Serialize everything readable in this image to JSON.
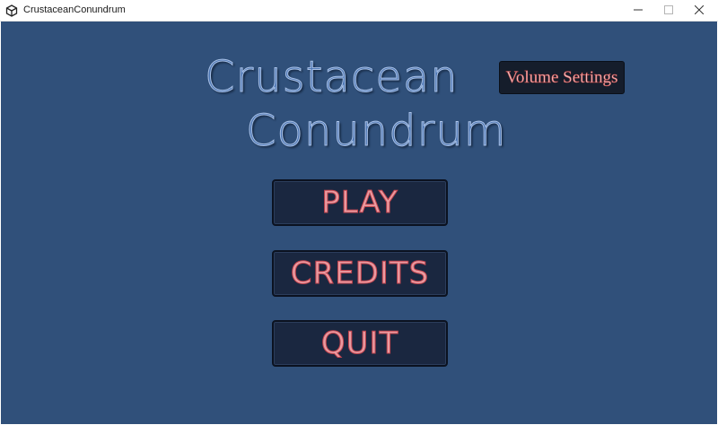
{
  "window": {
    "title": "CrustaceanConundrum",
    "icon": "unity-icon",
    "controls": {
      "minimize_icon": "minimize-icon",
      "maximize_icon": "maximize-icon",
      "close_icon": "close-icon"
    }
  },
  "game": {
    "title_line1": "Crustacean",
    "title_line2": "Conundrum",
    "volume_settings_label": "Volume Settings",
    "menu": {
      "play_label": "PLAY",
      "credits_label": "CREDITS",
      "quit_label": "QUIT"
    }
  },
  "colors": {
    "background": "#30507a",
    "title_fill": "#4a74b2",
    "button_fill": "#1a2740",
    "button_text": "#ea9aa0"
  }
}
